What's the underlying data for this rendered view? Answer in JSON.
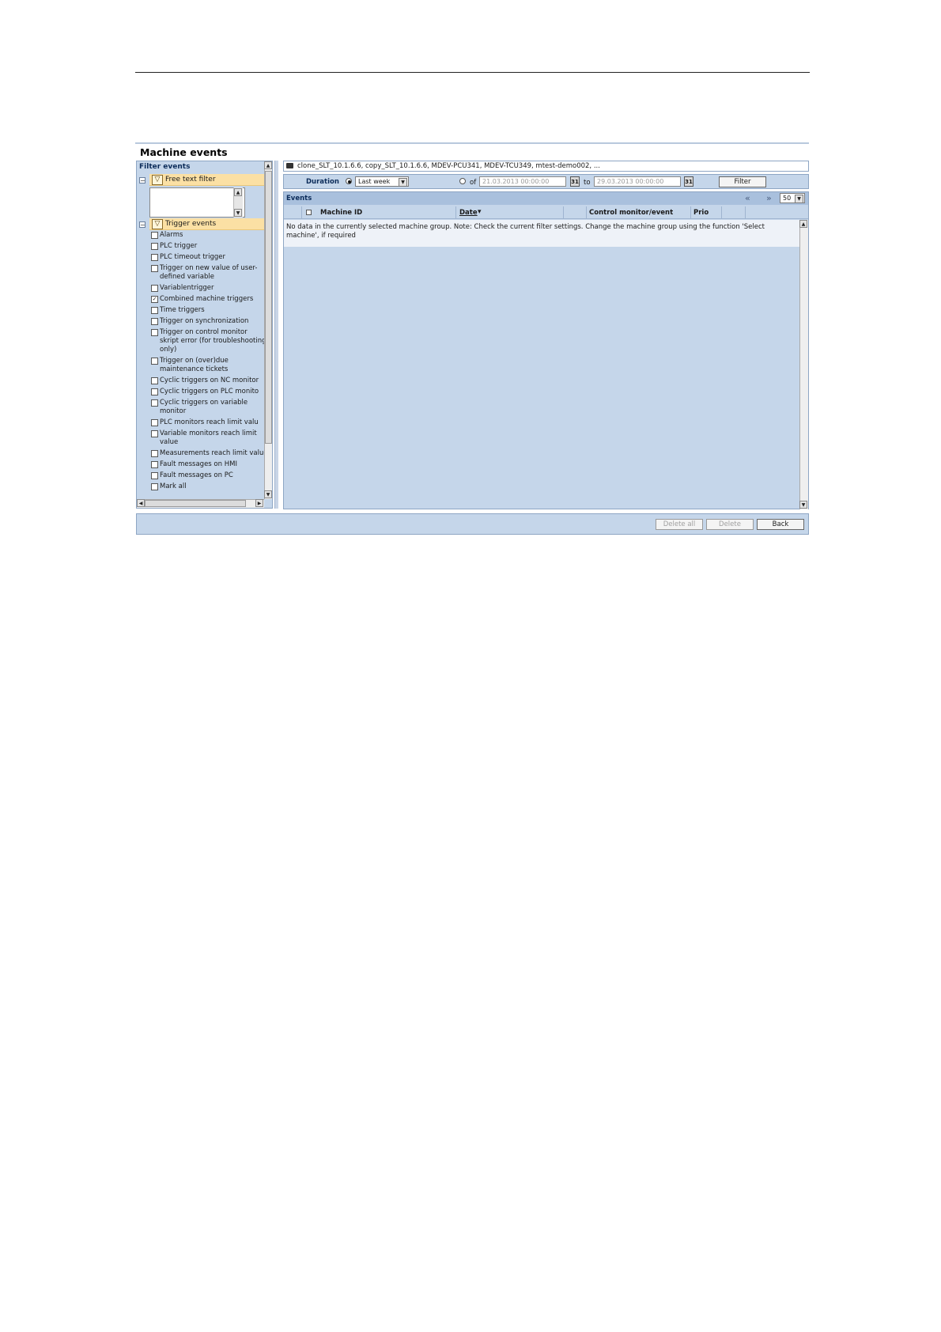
{
  "app": {
    "title": "Machine events"
  },
  "filter_panel": {
    "title": "Filter events",
    "free_text": {
      "label": "Free text filter"
    },
    "trigger_section": {
      "label": "Trigger events"
    },
    "triggers": [
      {
        "label": "Alarms",
        "checked": false
      },
      {
        "label": "PLC trigger",
        "checked": false
      },
      {
        "label": "PLC timeout trigger",
        "checked": false
      },
      {
        "label": "Trigger on new value of user-defined variable",
        "checked": false
      },
      {
        "label": "Variablentrigger",
        "checked": false
      },
      {
        "label": "Combined machine triggers",
        "checked": true
      },
      {
        "label": "Time triggers",
        "checked": false
      },
      {
        "label": "Trigger on synchronization",
        "checked": false
      },
      {
        "label": "Trigger on control monitor skript error (for troubleshooting only)",
        "checked": false
      },
      {
        "label": "Trigger on (over)due maintenance tickets",
        "checked": false
      },
      {
        "label": "Cyclic triggers on NC monitor",
        "checked": false
      },
      {
        "label": "Cyclic triggers on PLC monito",
        "checked": false
      },
      {
        "label": "Cyclic triggers on variable monitor",
        "checked": false
      },
      {
        "label": "PLC monitors reach limit valu",
        "checked": false
      },
      {
        "label": "Variable monitors reach limit value",
        "checked": false
      },
      {
        "label": "Measurements reach limit value",
        "checked": false
      },
      {
        "label": "Fault messages on HMI",
        "checked": false
      },
      {
        "label": "Fault messages on PC",
        "checked": false
      },
      {
        "label": "Mark all",
        "checked": false
      }
    ]
  },
  "machines": {
    "text": "clone_SLT_10.1.6.6, copy_SLT_10.1.6.6, MDEV-PCU341, MDEV-TCU349, mtest-demo002, ..."
  },
  "duration": {
    "label": "Duration",
    "preset": "Last week",
    "of_label": "of",
    "to_label": "to",
    "from_value": "21.03.2013 00:00:00",
    "to_value": "29.03.2013 00:00:00",
    "calendar_glyph": "31",
    "filter_label": "Filter"
  },
  "events": {
    "title": "Events",
    "page_size": "50",
    "columns": {
      "machine_id": "Machine ID",
      "date": "Date",
      "control": "Control monitor/event",
      "prio": "Prio"
    },
    "message": "No data in the currently selected machine group. Note: Check the current filter settings. Change the machine group using the function 'Select machine', if required"
  },
  "footer": {
    "delete_all": "Delete all",
    "delete": "Delete",
    "back": "Back"
  },
  "glyphs": {
    "minus": "−",
    "up": "▲",
    "down": "▼",
    "left": "◀",
    "right": "▶",
    "funnel": "▽",
    "check": "✓",
    "first": "«",
    "last": "»",
    "sort_desc": "▾"
  },
  "colors": {
    "panel": "#c5d6ea",
    "header_blue": "#a9c0dd",
    "section": "#fbe0a4",
    "title_text": "#0c2c5a"
  }
}
